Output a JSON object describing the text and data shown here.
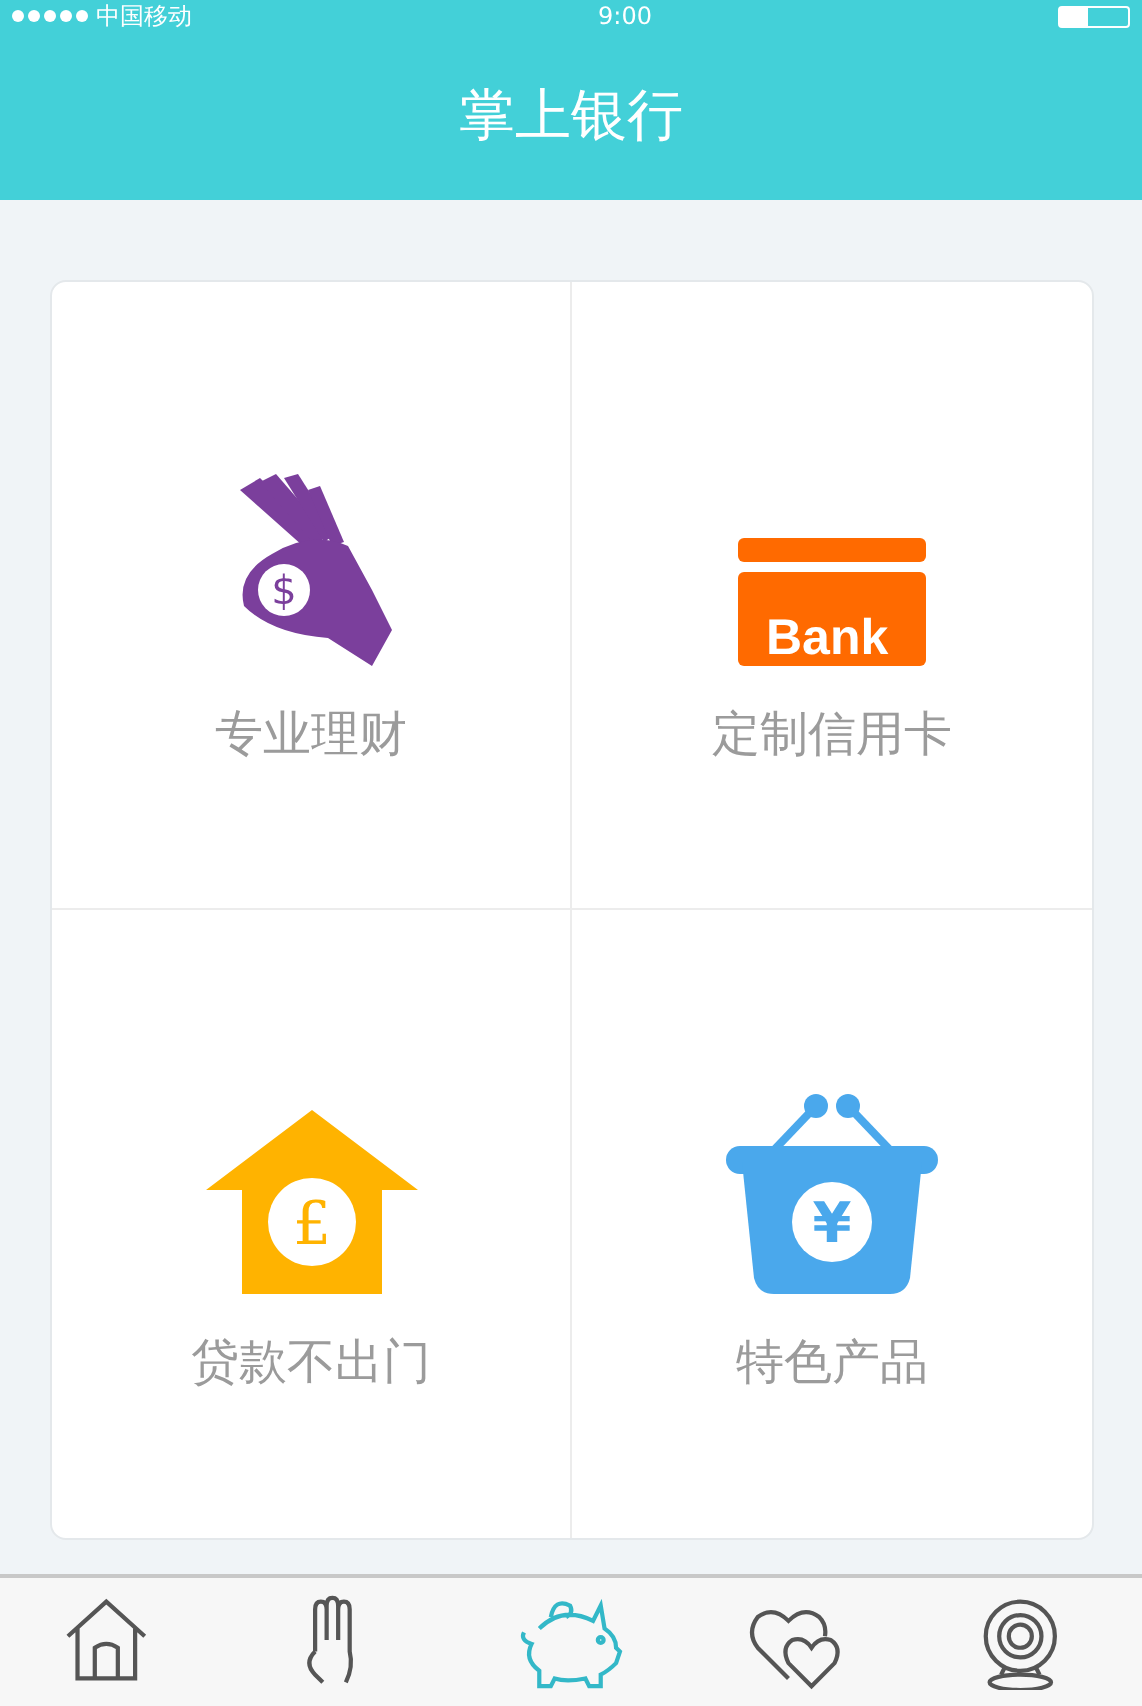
{
  "status_bar": {
    "carrier": "中国移动",
    "time": "9:00"
  },
  "header": {
    "title": "掌上银行"
  },
  "tiles": [
    {
      "kind": "hand",
      "label": "专业理财",
      "symbol": "$"
    },
    {
      "kind": "card",
      "label": "定制信用卡",
      "symbol": "Bank"
    },
    {
      "kind": "house",
      "label": "贷款不出门",
      "symbol": "£"
    },
    {
      "kind": "basket",
      "label": "特色产品",
      "symbol": "¥"
    }
  ],
  "tab_bar": [
    {
      "kind": "home",
      "selected": false
    },
    {
      "kind": "hand",
      "selected": false
    },
    {
      "kind": "piggy",
      "selected": true
    },
    {
      "kind": "hearts",
      "selected": false
    },
    {
      "kind": "webcam",
      "selected": false
    }
  ]
}
